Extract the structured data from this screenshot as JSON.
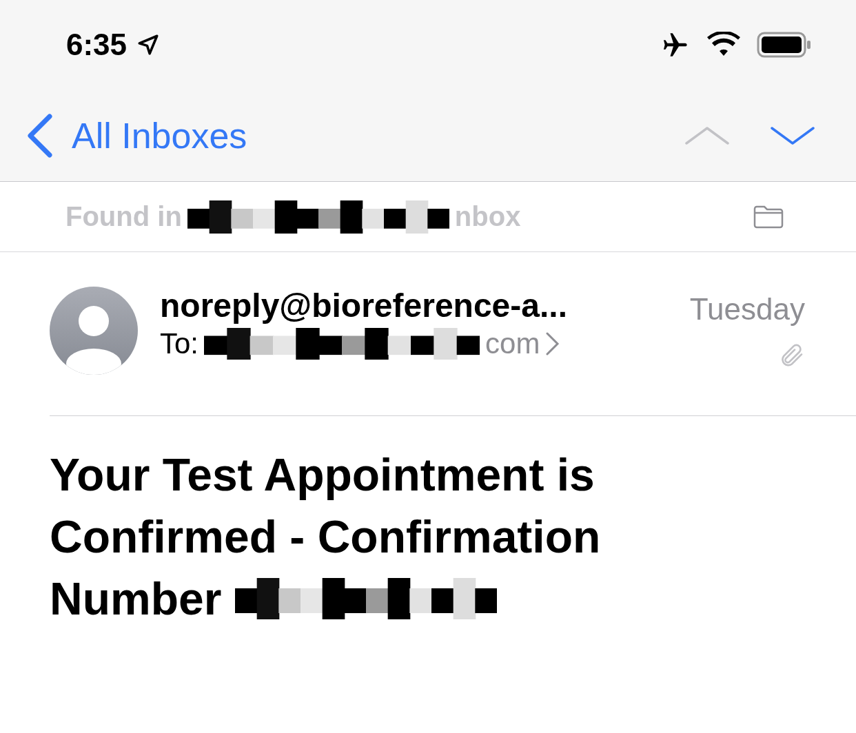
{
  "status_bar": {
    "time": "6:35"
  },
  "nav_bar": {
    "back_label": "All Inboxes",
    "arrows": [
      {
        "kind": "up",
        "disabled": true
      },
      {
        "kind": "down",
        "disabled": false
      }
    ]
  },
  "found_in": {
    "prefix": "Found in",
    "suffix": "nbox"
  },
  "message": {
    "sender": "noreply@bioreference-a...",
    "to_label": "To:",
    "to_suffix": "com",
    "date": "Tuesday",
    "subject_lines": [
      "Your Test Appointment is Confirmed - Confirmation",
      "Number"
    ]
  }
}
